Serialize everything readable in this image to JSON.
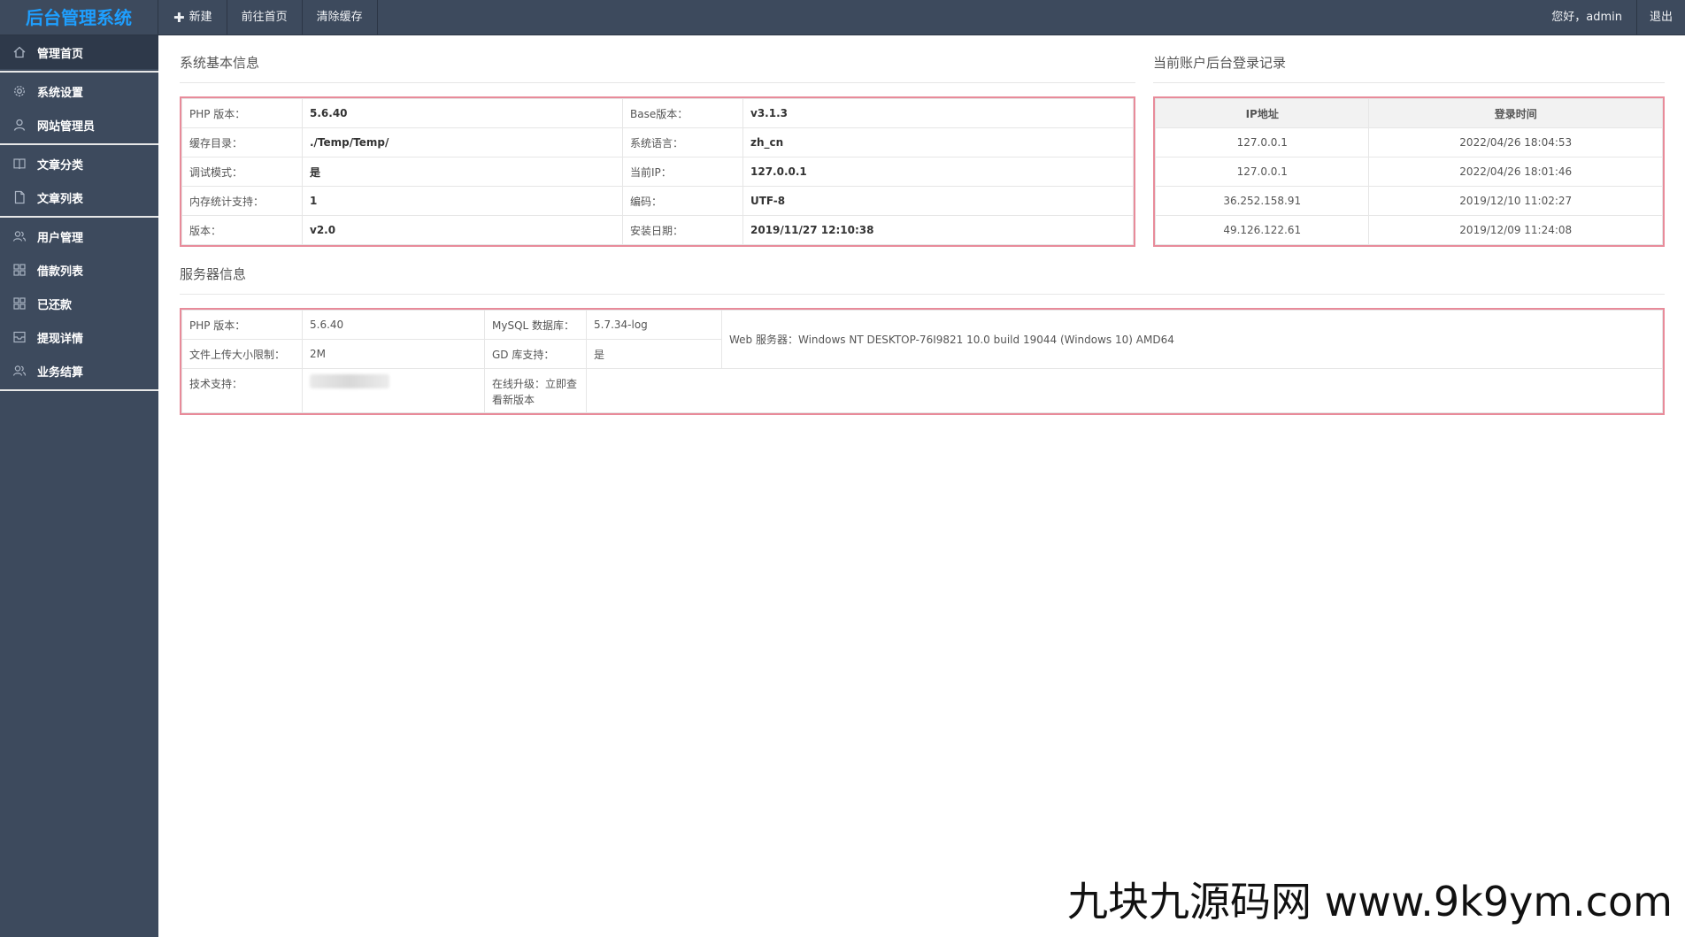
{
  "app": {
    "title": "后台管理系统"
  },
  "topnav": {
    "new": "新建",
    "home": "前往首页",
    "clear_cache": "清除缓存"
  },
  "topright": {
    "greeting": "您好，admin",
    "logout": "退出"
  },
  "sidebar": {
    "items": [
      {
        "label": "管理首页",
        "icon": "home-icon"
      },
      {
        "label": "系统设置",
        "icon": "gear-icon"
      },
      {
        "label": "网站管理员",
        "icon": "user-icon"
      },
      {
        "label": "文章分类",
        "icon": "book-icon"
      },
      {
        "label": "文章列表",
        "icon": "file-icon"
      },
      {
        "label": "用户管理",
        "icon": "users-icon"
      },
      {
        "label": "借款列表",
        "icon": "grid-icon"
      },
      {
        "label": "已还款",
        "icon": "grid-icon"
      },
      {
        "label": "提现详情",
        "icon": "tray-icon"
      },
      {
        "label": "业务结算",
        "icon": "users-icon"
      }
    ]
  },
  "basic": {
    "title": "系统基本信息",
    "rows": [
      [
        "PHP 版本：",
        "5.6.40",
        "Base版本：",
        "v3.1.3"
      ],
      [
        "缓存目录：",
        "./Temp/Temp/",
        "系统语言：",
        "zh_cn"
      ],
      [
        "调试模式：",
        "是",
        "当前IP：",
        "127.0.0.1"
      ],
      [
        "内存统计支持：",
        "1",
        "编码：",
        "UTF-8"
      ],
      [
        "版本：",
        "v2.0",
        "安装日期：",
        "2019/11/27 12:10:38"
      ]
    ]
  },
  "login": {
    "title": "当前账户后台登录记录",
    "headers": [
      "IP地址",
      "登录时间"
    ],
    "rows": [
      [
        "127.0.0.1",
        "2022/04/26 18:04:53"
      ],
      [
        "127.0.0.1",
        "2022/04/26 18:01:46"
      ],
      [
        "36.252.158.91",
        "2019/12/10 11:02:27"
      ],
      [
        "49.126.122.61",
        "2019/12/09 11:24:08"
      ]
    ]
  },
  "server": {
    "title": "服务器信息",
    "php_label": "PHP 版本：",
    "php_value": "5.6.40",
    "mysql_label": "MySQL 数据库：",
    "mysql_value": "5.7.34-log",
    "upload_label": "文件上传大小限制：",
    "upload_value": "2M",
    "gd_label": "GD 库支持：",
    "gd_value": "是",
    "web_server": "Web 服务器：Windows NT DESKTOP-76I9821 10.0 build 19044 (Windows 10) AMD64",
    "support_label": "技术支持：",
    "upgrade_label": "在线升级：立即查看新版本"
  },
  "watermark": "九块九源码网 www.9k9ym.com"
}
